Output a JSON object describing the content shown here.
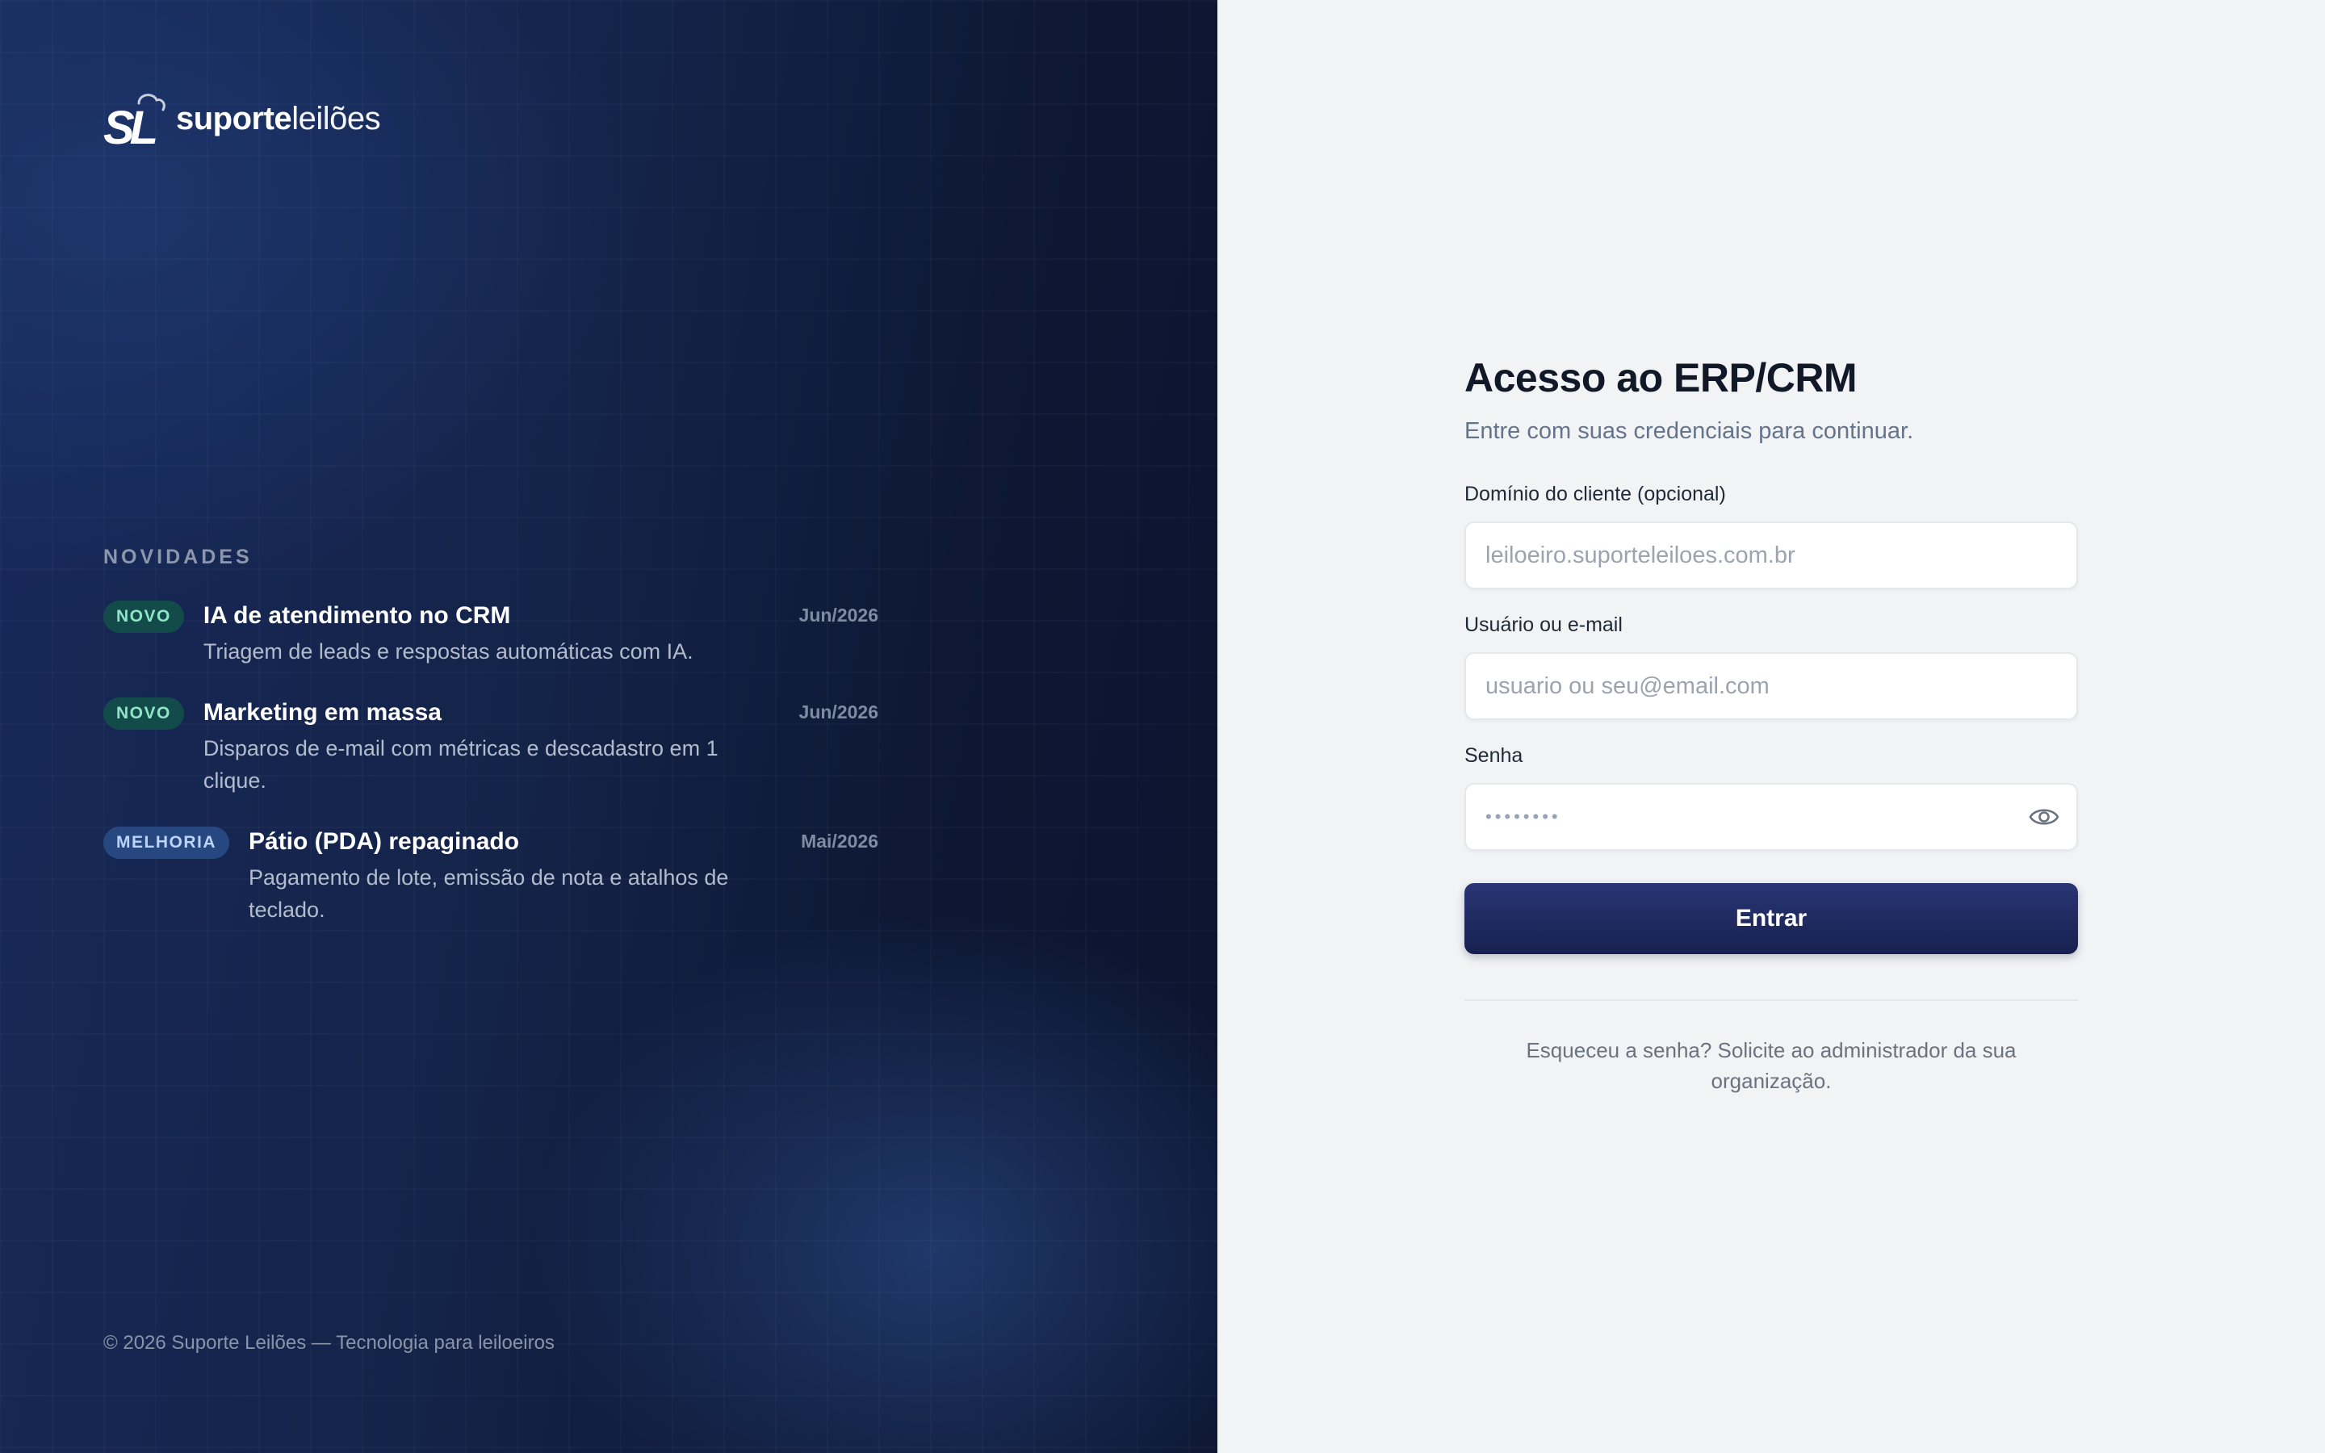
{
  "brand": {
    "logo_mark": "SL",
    "name_bold": "suporte",
    "name_light": "leilões"
  },
  "news": {
    "heading": "NOVIDADES",
    "items": [
      {
        "badge": "NOVO",
        "badge_type": "novo",
        "title": "IA de atendimento no CRM",
        "desc": "Triagem de leads e respostas automáticas com IA.",
        "date": "Jun/2026"
      },
      {
        "badge": "NOVO",
        "badge_type": "novo",
        "title": "Marketing em massa",
        "desc": "Disparos de e-mail com métricas e descadastro em 1 clique.",
        "date": "Jun/2026"
      },
      {
        "badge": "MELHORIA",
        "badge_type": "melhoria",
        "title": "Pátio (PDA) repaginado",
        "desc": "Pagamento de lote, emissão de nota e atalhos de teclado.",
        "date": "Mai/2026"
      }
    ]
  },
  "footer": {
    "copyright": "© 2026 Suporte Leilões — Tecnologia para leiloeiros"
  },
  "login": {
    "title": "Acesso ao ERP/CRM",
    "subtitle": "Entre com suas credenciais para continuar.",
    "domain_label": "Domínio do cliente (opcional)",
    "domain_placeholder": "leiloeiro.suporteleiloes.com.br",
    "user_label": "Usuário ou e-mail",
    "user_placeholder": "usuario ou seu@email.com",
    "password_label": "Senha",
    "password_mask": "••••••••",
    "password_toggle_icon": "eye-icon",
    "submit_label": "Entrar",
    "forgot_text": "Esqueceu a senha? Solicite ao administrador da sua organização."
  },
  "colors": {
    "left_bg": "#142348",
    "right_bg": "#f2f3f5",
    "button_bg": "#1f2a60",
    "badge_novo": "#134a4a",
    "badge_melhoria": "#26477f"
  }
}
